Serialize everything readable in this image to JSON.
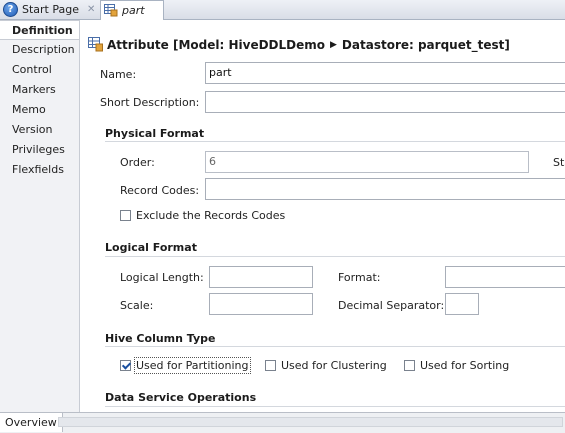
{
  "tabs": [
    {
      "label": "Start Page",
      "icon": "help-icon"
    },
    {
      "label": "part",
      "icon": "attribute-icon"
    }
  ],
  "nav": {
    "items": [
      "Definition",
      "Description",
      "Control",
      "Markers",
      "Memo",
      "Version",
      "Privileges",
      "Flexfields"
    ],
    "active": "Definition"
  },
  "header": {
    "prefix": "Attribute [Model: HiveDDLDemo",
    "arrow": "▶",
    "suffix": "Datastore: parquet_test]"
  },
  "form": {
    "name_label": "Name:",
    "name_value": "part",
    "short_desc_label": "Short Description:",
    "short_desc_value": ""
  },
  "physical": {
    "title": "Physical Format",
    "order_label": "Order:",
    "order_value": "6",
    "cut_label": "Sta",
    "record_codes_label": "Record Codes:",
    "record_codes_value": "",
    "exclude_label": "Exclude the Records Codes",
    "exclude_checked": false
  },
  "logical": {
    "title": "Logical Format",
    "length_label": "Logical Length:",
    "format_label": "Format:",
    "scale_label": "Scale:",
    "decimal_label": "Decimal Separator:"
  },
  "hive": {
    "title": "Hive Column Type",
    "partitioning_label": "Used for Partitioning",
    "partitioning_checked": true,
    "clustering_label": "Used for Clustering",
    "clustering_checked": false,
    "sorting_label": "Used for Sorting",
    "sorting_checked": false
  },
  "data_service": {
    "title": "Data Service Operations"
  },
  "bottom": {
    "overview_label": "Overview"
  }
}
